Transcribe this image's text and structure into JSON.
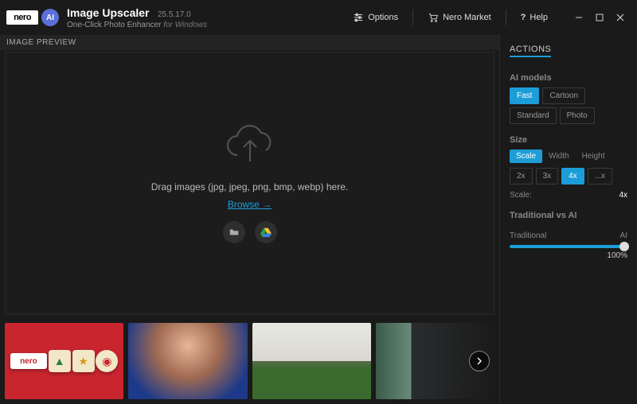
{
  "header": {
    "logo_text": "nero",
    "ai_badge": "AI",
    "app_title": "Image Upscaler",
    "version": "25.5.17.0",
    "subtitle_main": "One-Click Photo Enhancer",
    "subtitle_suffix": "for Windows",
    "options": "Options",
    "market": "Nero Market",
    "help": "Help"
  },
  "preview": {
    "label": "IMAGE PREVIEW",
    "drag_text": "Drag images (jpg, jpeg, png, bmp, webp) here.",
    "browse": "Browse →"
  },
  "gallery": {
    "thumb1_logo": "nero"
  },
  "actions": {
    "label": "ACTIONS",
    "ai_models_label": "AI models",
    "models": [
      "Fast",
      "Cartoon",
      "Standard",
      "Photo"
    ],
    "models_active": 0,
    "size_label": "Size",
    "size_tabs": [
      "Scale",
      "Width",
      "Height"
    ],
    "size_tab_active": 0,
    "scales": [
      "2x",
      "3x",
      "4x",
      "...x"
    ],
    "scales_active": 2,
    "scale_key": "Scale:",
    "scale_value": "4x",
    "trad_label": "Traditional vs AI",
    "slider_left": "Traditional",
    "slider_right": "AI",
    "slider_value": "100%"
  }
}
